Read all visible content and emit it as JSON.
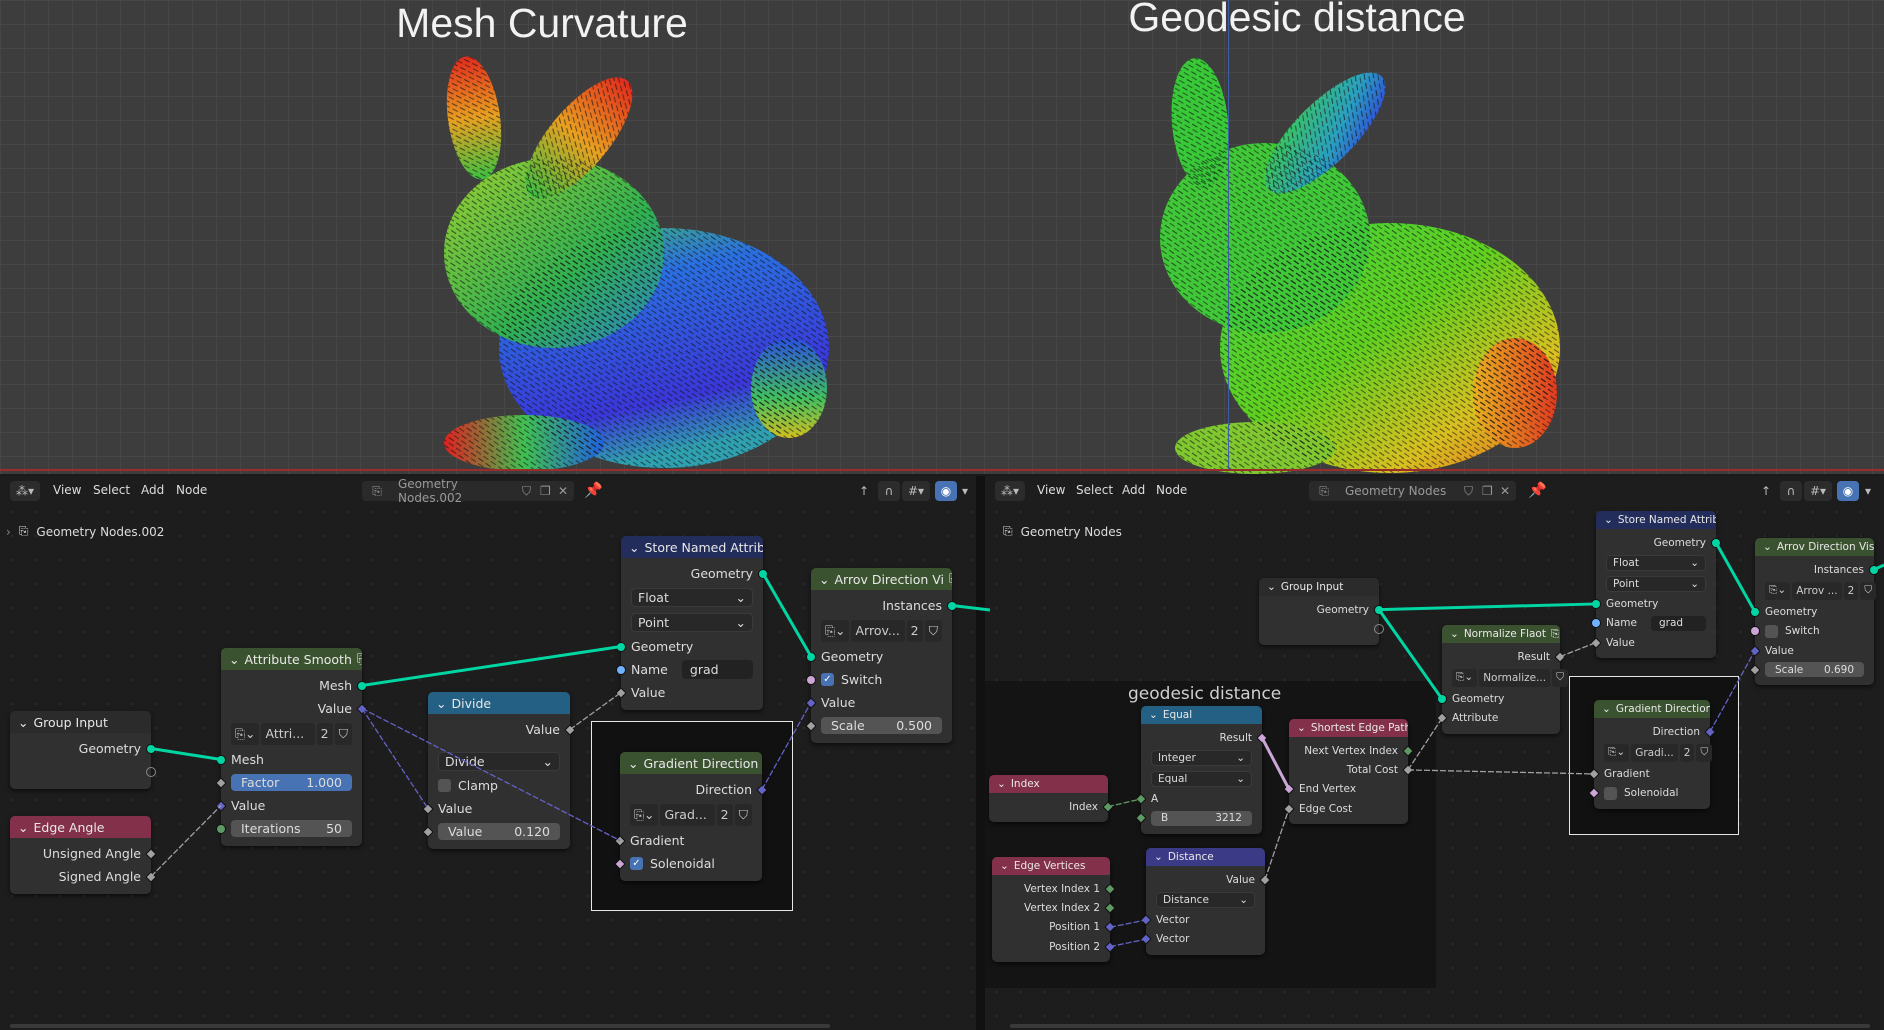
{
  "viewport": {
    "title_left": "Mesh Curvature",
    "title_right": "Geodesic distance"
  },
  "editors": {
    "left": {
      "menus": [
        "View",
        "Select",
        "Add",
        "Node"
      ],
      "datablock": "Geometry Nodes.002",
      "breadcrumb": "Geometry Nodes.002"
    },
    "right": {
      "menus": [
        "View",
        "Select",
        "Add",
        "Node"
      ],
      "datablock": "Geometry Nodes",
      "breadcrumb": "Geometry Nodes",
      "frame_label": "geodesic distance"
    }
  },
  "colors": {
    "geometry": "#00d6a3",
    "float": "#a1a1a1",
    "vector": "#6363c7",
    "boolean": "#cca6d6",
    "integer": "#5f9963",
    "shader_green": "#3b5230",
    "input_red": "#83314a",
    "converter_blue": "#236083",
    "attribute_navy": "#232d5b",
    "vector_purple": "#3b3a86",
    "accent": "#4772b3"
  },
  "nodes": {
    "gi_l": {
      "title": "Group Input",
      "header": "#2b2b2b",
      "rows": [
        {
          "t": "out",
          "label": "Geometry",
          "s": "geometry"
        },
        {
          "t": "out",
          "label": "",
          "s": "hollow"
        }
      ]
    },
    "edge_angle": {
      "title": "Edge Angle",
      "header": "#83314a",
      "rows": [
        {
          "t": "out",
          "label": "Unsigned Angle",
          "s": "float",
          "dia": true
        },
        {
          "t": "out",
          "label": "Signed Angle",
          "s": "float",
          "dia": true
        }
      ]
    },
    "smooth": {
      "title": "Attribute Smooth",
      "header": "#3b5230",
      "group_icon": true,
      "rows": [
        {
          "t": "out",
          "label": "Mesh",
          "s": "geometry"
        },
        {
          "t": "out",
          "label": "Value",
          "s": "vector",
          "dia": true
        },
        {
          "t": "group",
          "name": "Attri...",
          "users": "2"
        },
        {
          "t": "in",
          "label": "Mesh",
          "s": "geometry"
        },
        {
          "t": "slider",
          "label": "Factor",
          "value": "1.000",
          "blue": true,
          "s": "float",
          "dia": true
        },
        {
          "t": "in",
          "label": "Value",
          "s": "vector",
          "dia": true
        },
        {
          "t": "slider",
          "label": "Iterations",
          "value": "50",
          "s": "integer"
        }
      ]
    },
    "divide": {
      "title": "Divide",
      "header": "#236083",
      "rows": [
        {
          "t": "out",
          "label": "Value",
          "s": "float",
          "dia": true
        },
        {
          "t": "select",
          "value": "Divide",
          "gap": true
        },
        {
          "t": "check",
          "label": "Clamp",
          "checked": false
        },
        {
          "t": "in",
          "label": "Value",
          "s": "float",
          "dia": true
        },
        {
          "t": "slider",
          "label": "Value",
          "value": "0.120",
          "s": "float",
          "dia": true
        }
      ]
    },
    "store_l": {
      "title": "Store Named Attribut",
      "header": "#232d5b",
      "rows": [
        {
          "t": "out",
          "label": "Geometry",
          "s": "geometry"
        },
        {
          "t": "select",
          "value": "Float"
        },
        {
          "t": "select",
          "value": "Point"
        },
        {
          "t": "in",
          "label": "Geometry",
          "s": "geometry"
        },
        {
          "t": "field",
          "label": "Name",
          "value": "grad",
          "s": "string"
        },
        {
          "t": "in",
          "label": "Value",
          "s": "float",
          "dia": true
        }
      ]
    },
    "arrow_l": {
      "title": "Arrov Direction Vi",
      "header": "#3b5230",
      "group_icon": true,
      "rows": [
        {
          "t": "out",
          "label": "Instances",
          "s": "geometry"
        },
        {
          "t": "group",
          "name": "Arrov...",
          "users": "2"
        },
        {
          "t": "in",
          "label": "Geometry",
          "s": "geometry"
        },
        {
          "t": "check",
          "label": "Switch",
          "checked": true,
          "s": "boolean"
        },
        {
          "t": "in",
          "label": "Value",
          "s": "vector",
          "dia": true
        },
        {
          "t": "slider",
          "label": "Scale",
          "value": "0.500",
          "s": "float",
          "dia": true
        }
      ]
    },
    "grad_l": {
      "title": "Gradient Direction",
      "header": "#3b5230",
      "group_icon": true,
      "rows": [
        {
          "t": "out",
          "label": "Direction",
          "s": "vector",
          "dia": true
        },
        {
          "t": "group",
          "name": "Grad...",
          "users": "2"
        },
        {
          "t": "in",
          "label": "Gradient",
          "s": "float",
          "dia": true
        },
        {
          "t": "check",
          "label": "Solenoidal",
          "checked": true,
          "s": "boolean",
          "dia": true
        }
      ]
    },
    "gi_r": {
      "title": "Group Input",
      "header": "#2b2b2b",
      "rows": [
        {
          "t": "out",
          "label": "Geometry",
          "s": "geometry"
        },
        {
          "t": "out",
          "label": "",
          "s": "hollow"
        }
      ]
    },
    "normalize": {
      "title": "Normalize Flaot",
      "header": "#3b5230",
      "group_icon": true,
      "rows": [
        {
          "t": "out",
          "label": "Result",
          "s": "float",
          "dia": true
        },
        {
          "t": "group",
          "name": "Normalize...",
          "users": ""
        },
        {
          "t": "in",
          "label": "Geometry",
          "s": "geometry"
        },
        {
          "t": "in",
          "label": "Attribute",
          "s": "float",
          "dia": true
        }
      ]
    },
    "store_r": {
      "title": "Store Named Attribute",
      "header": "#232d5b",
      "rows": [
        {
          "t": "out",
          "label": "Geometry",
          "s": "geometry"
        },
        {
          "t": "select",
          "value": "Float"
        },
        {
          "t": "select",
          "value": "Point"
        },
        {
          "t": "in",
          "label": "Geometry",
          "s": "geometry"
        },
        {
          "t": "field",
          "label": "Name",
          "value": "grad",
          "s": "string"
        },
        {
          "t": "in",
          "label": "Value",
          "s": "float",
          "dia": true
        }
      ]
    },
    "arrow_r": {
      "title": "Arrov Direction Visu",
      "header": "#3b5230",
      "group_icon": true,
      "rows": [
        {
          "t": "out",
          "label": "Instances",
          "s": "geometry"
        },
        {
          "t": "group",
          "name": "Arrov ...",
          "users": "2"
        },
        {
          "t": "in",
          "label": "Geometry",
          "s": "geometry"
        },
        {
          "t": "check",
          "label": "Switch",
          "checked": false,
          "s": "boolean"
        },
        {
          "t": "in",
          "label": "Value",
          "s": "vector",
          "dia": true
        },
        {
          "t": "slider",
          "label": "Scale",
          "value": "0.690",
          "s": "float",
          "dia": true
        }
      ]
    },
    "grad_r": {
      "title": "Gradient Direction",
      "header": "#3b5230",
      "group_icon": true,
      "rows": [
        {
          "t": "out",
          "label": "Direction",
          "s": "vector",
          "dia": true
        },
        {
          "t": "group",
          "name": "Gradi...",
          "users": "2"
        },
        {
          "t": "in",
          "label": "Gradient",
          "s": "float",
          "dia": true
        },
        {
          "t": "check",
          "label": "Solenoidal",
          "checked": false,
          "s": "boolean",
          "dia": true
        }
      ]
    },
    "equal": {
      "title": "Equal",
      "header": "#236083",
      "rows": [
        {
          "t": "out",
          "label": "Result",
          "s": "boolean",
          "dia": true
        },
        {
          "t": "select",
          "value": "Integer"
        },
        {
          "t": "select",
          "value": "Equal"
        },
        {
          "t": "in",
          "label": "A",
          "s": "integer",
          "dia": true
        },
        {
          "t": "slider",
          "label": "B",
          "value": "3212",
          "s": "integer",
          "dia": true
        }
      ]
    },
    "index": {
      "title": "Index",
      "header": "#83314a",
      "rows": [
        {
          "t": "out",
          "label": "Index",
          "s": "integer",
          "dia": true
        }
      ]
    },
    "edgev": {
      "title": "Edge Vertices",
      "header": "#83314a",
      "rows": [
        {
          "t": "out",
          "label": "Vertex Index 1",
          "s": "integer",
          "dia": true
        },
        {
          "t": "out",
          "label": "Vertex Index 2",
          "s": "integer",
          "dia": true
        },
        {
          "t": "out",
          "label": "Position 1",
          "s": "vector",
          "dia": true
        },
        {
          "t": "out",
          "label": "Position 2",
          "s": "vector",
          "dia": true
        }
      ]
    },
    "distance": {
      "title": "Distance",
      "header": "#3b3a86",
      "rows": [
        {
          "t": "out",
          "label": "Value",
          "s": "float",
          "dia": true
        },
        {
          "t": "select",
          "value": "Distance"
        },
        {
          "t": "in",
          "label": "Vector",
          "s": "vector",
          "dia": true
        },
        {
          "t": "in",
          "label": "Vector",
          "s": "vector",
          "dia": true
        }
      ]
    },
    "shortest": {
      "title": "Shortest Edge Paths",
      "header": "#83314a",
      "rows": [
        {
          "t": "out",
          "label": "Next Vertex Index",
          "s": "integer",
          "dia": true
        },
        {
          "t": "out",
          "label": "Total Cost",
          "s": "float",
          "dia": true
        },
        {
          "t": "in",
          "label": "End Vertex",
          "s": "boolean",
          "dia": true
        },
        {
          "t": "in",
          "label": "Edge Cost",
          "s": "float",
          "dia": true
        }
      ]
    }
  }
}
